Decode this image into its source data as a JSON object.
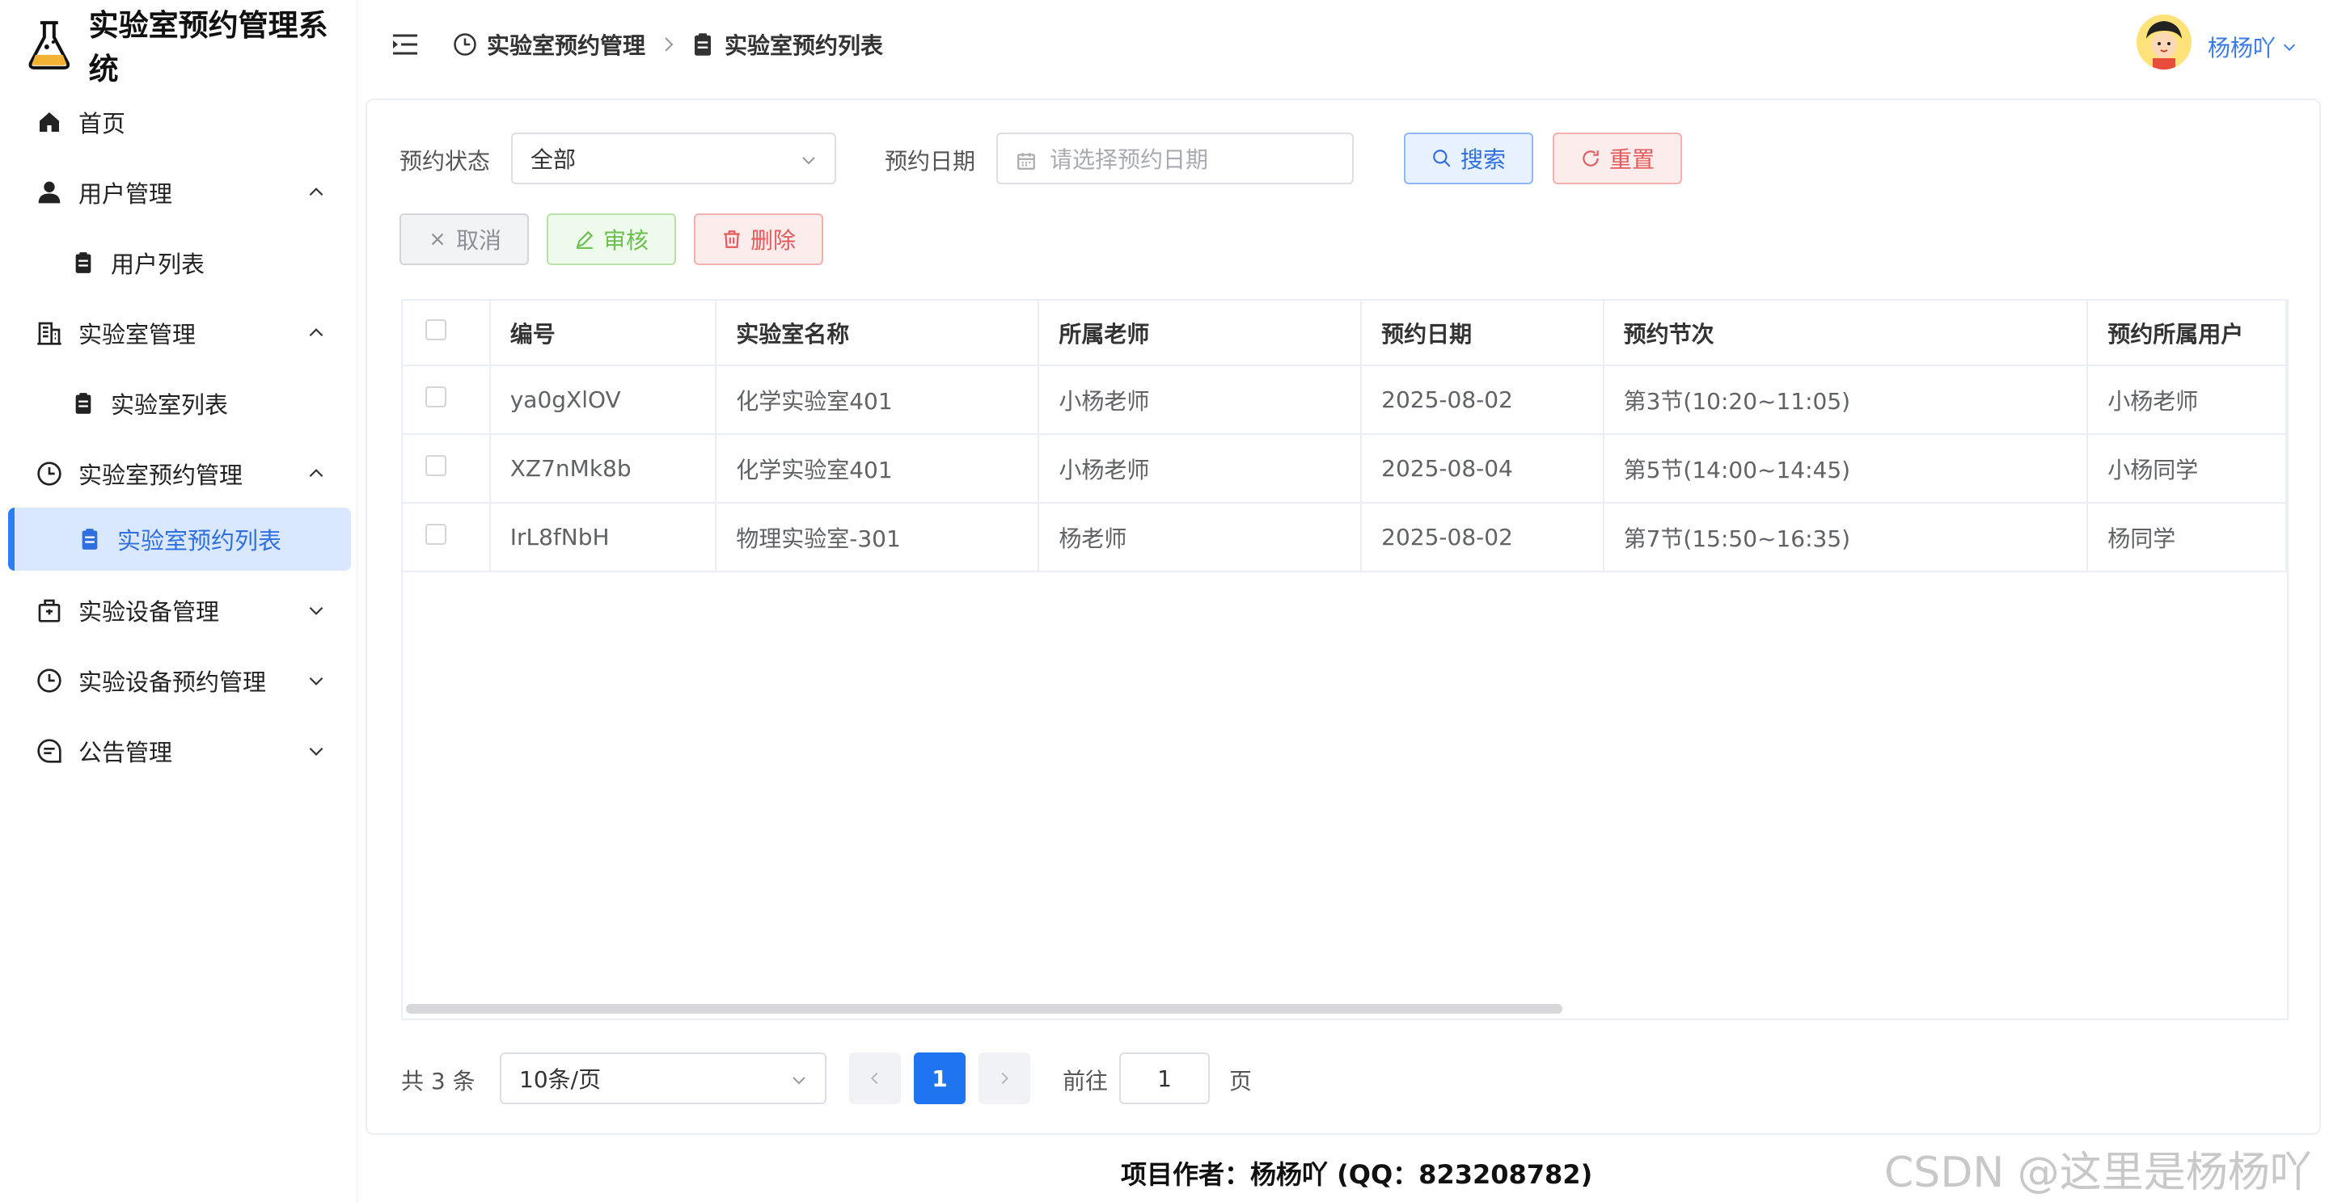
{
  "app": {
    "title": "实验室预约管理系统"
  },
  "sidebar": {
    "items": [
      {
        "label": "首页",
        "icon": "home-icon"
      },
      {
        "label": "用户管理",
        "icon": "user-icon",
        "expanded": true
      },
      {
        "label": "用户列表",
        "icon": "clipboard-icon"
      },
      {
        "label": "实验室管理",
        "icon": "building-icon",
        "expanded": true
      },
      {
        "label": "实验室列表",
        "icon": "clipboard-icon"
      },
      {
        "label": "实验室预约管理",
        "icon": "clock-icon",
        "expanded": true
      },
      {
        "label": "实验室预约列表",
        "icon": "clipboard-icon",
        "active": true
      },
      {
        "label": "实验设备管理",
        "icon": "box-icon",
        "expanded": false
      },
      {
        "label": "实验设备预约管理",
        "icon": "clock-icon",
        "expanded": false
      },
      {
        "label": "公告管理",
        "icon": "chat-icon",
        "expanded": false
      }
    ]
  },
  "header": {
    "breadcrumb": [
      "实验室预约管理",
      "实验室预约列表"
    ],
    "user_name": "杨杨吖"
  },
  "filters": {
    "status_label": "预约状态",
    "status_value": "全部",
    "date_label": "预约日期",
    "date_placeholder": "请选择预约日期",
    "search_label": "搜索",
    "reset_label": "重置"
  },
  "actions": {
    "cancel_label": "取消",
    "audit_label": "审核",
    "delete_label": "删除"
  },
  "table": {
    "columns": [
      "编号",
      "实验室名称",
      "所属老师",
      "预约日期",
      "预约节次",
      "预约所属用户"
    ],
    "rows": [
      [
        "ya0gXlOV",
        "化学实验室401",
        "小杨老师",
        "2025-08-02",
        "第3节(10:20~11:05)",
        "小杨老师"
      ],
      [
        "XZ7nMk8b",
        "化学实验室401",
        "小杨老师",
        "2025-08-04",
        "第5节(14:00~14:45)",
        "小杨同学"
      ],
      [
        "IrL8fNbH",
        "物理实验室-301",
        "杨老师",
        "2025-08-02",
        "第7节(15:50~16:35)",
        "杨同学"
      ]
    ]
  },
  "pagination": {
    "total_text": "共 3 条",
    "page_size": "10条/页",
    "current_page": "1",
    "goto_label": "前往",
    "goto_value": "1",
    "page_suffix": "页"
  },
  "footer": {
    "text": "项目作者：杨杨吖 (QQ：823208782)"
  },
  "watermark": {
    "text": "CSDN @这里是杨杨吖"
  },
  "colors": {
    "primary": "#1f74f0",
    "danger": "#e55a5a",
    "success": "#6bbf4f",
    "active_bg": "#d9e8ff"
  }
}
